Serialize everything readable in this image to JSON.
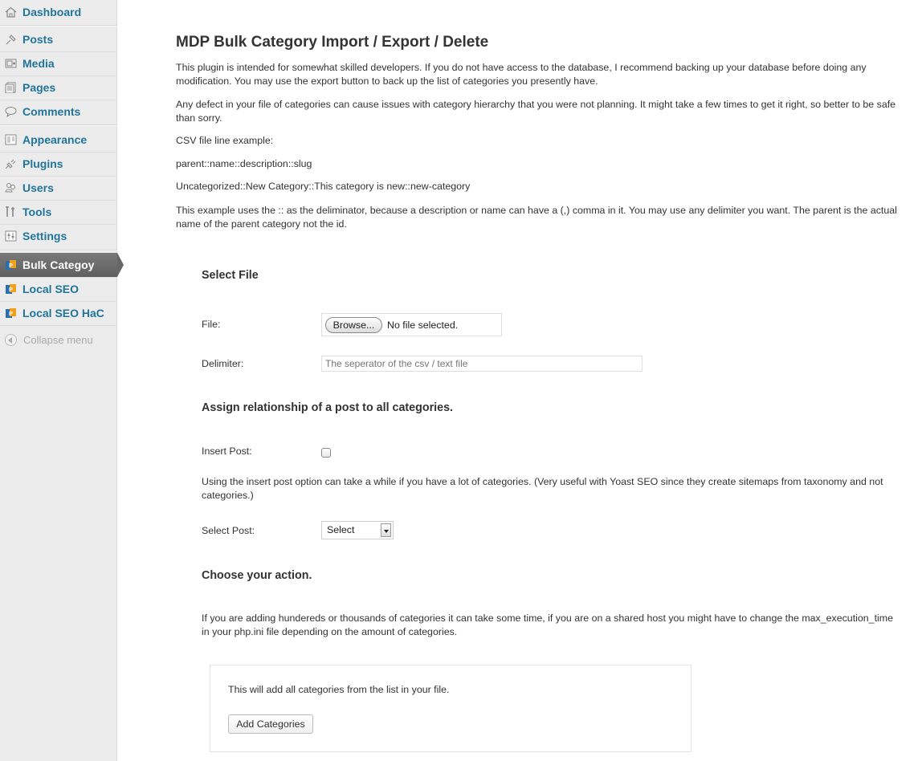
{
  "sidebar": {
    "items": [
      {
        "label": "Dashboard",
        "icon": "home-icon"
      },
      {
        "label": "Posts",
        "icon": "pin-icon"
      },
      {
        "label": "Media",
        "icon": "media-icon"
      },
      {
        "label": "Pages",
        "icon": "pages-icon"
      },
      {
        "label": "Comments",
        "icon": "comment-icon"
      },
      {
        "label": "Appearance",
        "icon": "appearance-icon"
      },
      {
        "label": "Plugins",
        "icon": "plug-icon"
      },
      {
        "label": "Users",
        "icon": "users-icon"
      },
      {
        "label": "Tools",
        "icon": "tools-icon"
      },
      {
        "label": "Settings",
        "icon": "settings-icon"
      },
      {
        "label": "Bulk Categoy",
        "icon": "plugin-logo-icon",
        "current": true
      },
      {
        "label": "Local SEO",
        "icon": "plugin-logo-icon"
      },
      {
        "label": "Local SEO HaC",
        "icon": "plugin-logo-icon"
      }
    ],
    "collapse_label": "Collapse menu"
  },
  "page": {
    "title": "MDP Bulk Category Import / Export / Delete",
    "intro": "This plugin is intended for somewhat skilled developers. If you do not have access to the database, I recommend backing up your database before doing any modification. You may use the export button to back up the list of categories you presently have.",
    "warning": "Any defect in your file of categories can cause issues with category hierarchy that you were not planning. It might take a few times to get it right, so better to be safe than sorry.",
    "csv_example_label": "CSV file line example:",
    "csv_format": "parent::name::description::slug",
    "csv_example": "Uncategorized::New Category::This category is new::new-category",
    "delimiter_note": "This example uses the :: as the deliminator, because a description or name can have a (,) comma in it. You may use any delimiter you want. The parent is the actual name of the parent category not the id."
  },
  "form": {
    "select_file_heading": "Select File",
    "file_label": "File:",
    "browse_label": "Browse...",
    "no_file_text": "No file selected.",
    "delimiter_label": "Delimiter:",
    "delimiter_placeholder": "The seperator of the csv / text file",
    "assign_heading": "Assign relationship of a post to all categories.",
    "insert_post_label": "Insert Post:",
    "insert_post_checked": false,
    "insert_post_note": "Using the insert post option can take a while if you have a lot of categories. (Very useful with Yoast SEO since they create sitemaps from taxonomy and not categories.)",
    "select_post_label": "Select Post:",
    "select_post_value": "Select",
    "action_heading": "Choose your action.",
    "action_note": "If you are adding hundereds or thousands of categories it can take some time, if you are on a shared host you might have to change the max_execution_time in your php.ini file depending on the amount of categories.",
    "add_note": "This will add all categories from the list in your file.",
    "add_button": "Add Categories"
  }
}
